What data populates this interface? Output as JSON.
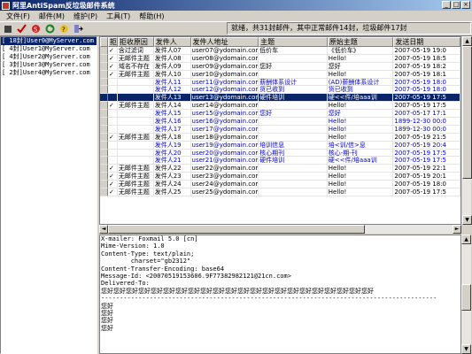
{
  "window": {
    "title": "阿里AntiSpam反垃圾邮件系统",
    "buttons": [
      "_",
      "□",
      "×"
    ]
  },
  "menu": [
    "文件(F)",
    "邮件(M)",
    "维护(P)",
    "工具(T)",
    "帮助(H)"
  ],
  "toolbar": {
    "icons": [
      "stop-icon",
      "check-icon",
      "mark-spam-icon",
      "refresh-icon",
      "help-icon",
      "exit-icon"
    ],
    "status_text": "就绪，共31封邮件，其中正常邮件14封，垃圾邮件17封"
  },
  "folders": [
    "[ 18封]User0@MyServer.com",
    "[ 4封]User1@MyServer.com",
    "[ 4封]User2@MyServer.com",
    "[ 3封]User3@MyServer.com",
    "[ 2封]User4@MyServer.com"
  ],
  "grid": {
    "columns": [
      "",
      "拒",
      "拒收原因",
      "发件人",
      "发件人地址",
      "主题",
      "原始主题",
      "发送日期"
    ],
    "rows": [
      [
        "",
        "✓",
        "含过滤词",
        "发件人07",
        "user07@ydomain.com",
        "低价车",
        "《低价车》",
        "2007-05-19 19:0"
      ],
      [
        "",
        "✓",
        "无邮件主题",
        "发件人08",
        "user08@ydomain.com",
        "",
        "Hello!",
        "2007-05-19 18:5"
      ],
      [
        "",
        "✓",
        "域名不存在",
        "发件人09",
        "user09@ydomain.com",
        "您好",
        "您好",
        "2007-05-19 18:2"
      ],
      [
        "",
        "✓",
        "无邮件主题",
        "发件人10",
        "user10@ydomain.com",
        "",
        "Hello!",
        "2007-05-19 18:1"
      ],
      [
        "",
        "",
        "",
        "发件人11",
        "user11@ydomain.com",
        "薪酬体系设计",
        "(AD)薪酬体系设计",
        "2007-05-19 18:0"
      ],
      [
        "",
        "",
        "",
        "发件人12",
        "user12@ydomain.com",
        "货已收到",
        "货已收到",
        "2007-05-19 18:0"
      ],
      [
        "",
        "",
        "",
        "发件人13",
        "user13@ydomain.com",
        "硬件培训",
        "硬<<件/培aaa训",
        "2007-05-19 17:5"
      ],
      [
        "",
        "✓",
        "无邮件主题",
        "发件人14",
        "user14@ydomain.com",
        "",
        "Hello!",
        "2007-05-19 17:5"
      ],
      [
        "",
        "",
        "",
        "发件人15",
        "user15@ydomain.com",
        "您好",
        "您好",
        "2007-05-17 17:1"
      ],
      [
        "",
        "",
        "",
        "发件人16",
        "user16@ydomain.com",
        "",
        "Hello!",
        "1899-12-30 00:0"
      ],
      [
        "",
        "",
        "",
        "发件人17",
        "user17@ydomain.com",
        "",
        "Hello!",
        "1899-12-30 00:0"
      ],
      [
        "",
        "✓",
        "无邮件主题",
        "发件人18",
        "user18@ydomain.com",
        "",
        "Hello!",
        "2007-05-19 21:5"
      ],
      [
        "",
        "",
        "",
        "发件人19",
        "user19@ydomain.com",
        "培训信息",
        "培<训/信>息",
        "2007-05-19 20:4"
      ],
      [
        "",
        "",
        "",
        "发件人20",
        "user20@ydomain.com",
        "核心期刊",
        "核心-期-刊",
        "2007-05-19 17:5"
      ],
      [
        "",
        "",
        "",
        "发件人21",
        "user21@ydomain.com",
        "硬件培训",
        "硬<<件/培aaa训",
        "2007-05-19 17:5"
      ],
      [
        "",
        "✓",
        "无邮件主题",
        "发件人22",
        "user22@ydomain.com",
        "",
        "Hello!",
        "2007-05-19 22:1"
      ],
      [
        "",
        "✓",
        "无邮件主题",
        "发件人23",
        "user23@ydomain.com",
        "",
        "Hello!",
        "2007-05-19 20:1"
      ],
      [
        "",
        "✓",
        "无邮件主题",
        "发件人24",
        "user24@ydomain.com",
        "",
        "Hello!",
        "2007-05-19 18:0"
      ],
      [
        "",
        "✓",
        "无邮件主题",
        "发件人25",
        "user25@ydomain.com",
        "",
        "Hello!",
        "2007-05-19 17:5"
      ]
    ],
    "row_styles": [
      "black",
      "black",
      "black",
      "black",
      "blue",
      "blue",
      "blue",
      "black",
      "blue",
      "blue",
      "blue",
      "black",
      "blue",
      "blue",
      "blue",
      "black",
      "black",
      "black",
      "black"
    ],
    "selected_row": 6
  },
  "body": {
    "lines": [
      "X-mailer: Foxmail 5.0 [cn]",
      "Mime-Version: 1.0",
      "Content-Type: text/plain;",
      "        charset=\"gb2312\"",
      "Content-Transfer-Encoding: base64",
      "Message-Id: <20070519153606.9F77382982121@21cn.com>",
      "Delivered-To:",
      "",
      "",
      "您好您好您好您好您好您好您好您好您好您好您好您好您好您好您好您好您好您好您好您好您好您好",
      "",
      "------------------------------------------------------------------------------------------",
      "",
      "您好",
      "您好",
      "您好",
      "您好"
    ]
  },
  "colors": {
    "title_start": "#0a246a",
    "title_end": "#a6caf0",
    "blue_text": "#0000c8",
    "selected_bg": "#0a246a"
  }
}
